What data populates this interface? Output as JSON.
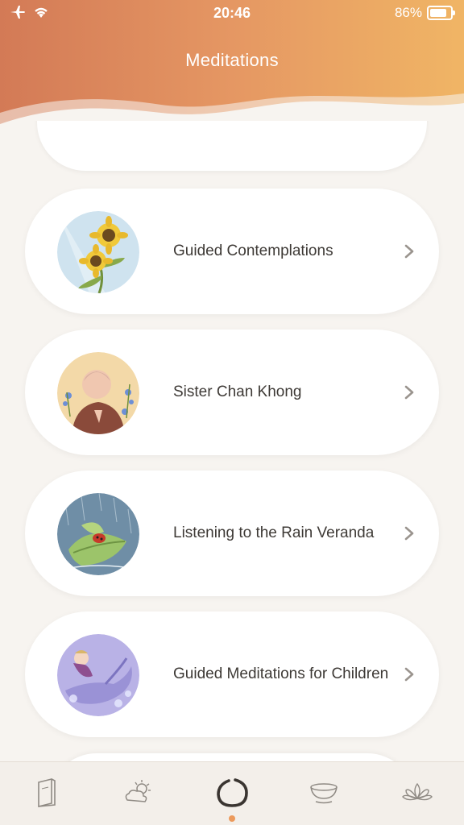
{
  "status": {
    "time": "20:46",
    "battery": "86%"
  },
  "header": {
    "title": "Meditations"
  },
  "items": [
    {
      "label": "Guided Contemplations",
      "thumb": "sunflower-thumbnail"
    },
    {
      "label": "Sister Chan Khong",
      "thumb": "sister-chan-khong-thumbnail"
    },
    {
      "label": "Listening to the Rain Veranda",
      "thumb": "rain-leaf-ladybug-thumbnail"
    },
    {
      "label": "Guided Meditations for Children",
      "thumb": "child-on-dragon-thumbnail"
    }
  ],
  "tabs": [
    {
      "name": "book-icon"
    },
    {
      "name": "weather-cloud-sun-icon"
    },
    {
      "name": "enso-circle-icon",
      "active": true
    },
    {
      "name": "tea-cup-icon"
    },
    {
      "name": "lotus-icon"
    }
  ],
  "colors": {
    "header_start": "#d37a56",
    "header_end": "#f0b565",
    "active_dot": "#ec9a5c"
  }
}
